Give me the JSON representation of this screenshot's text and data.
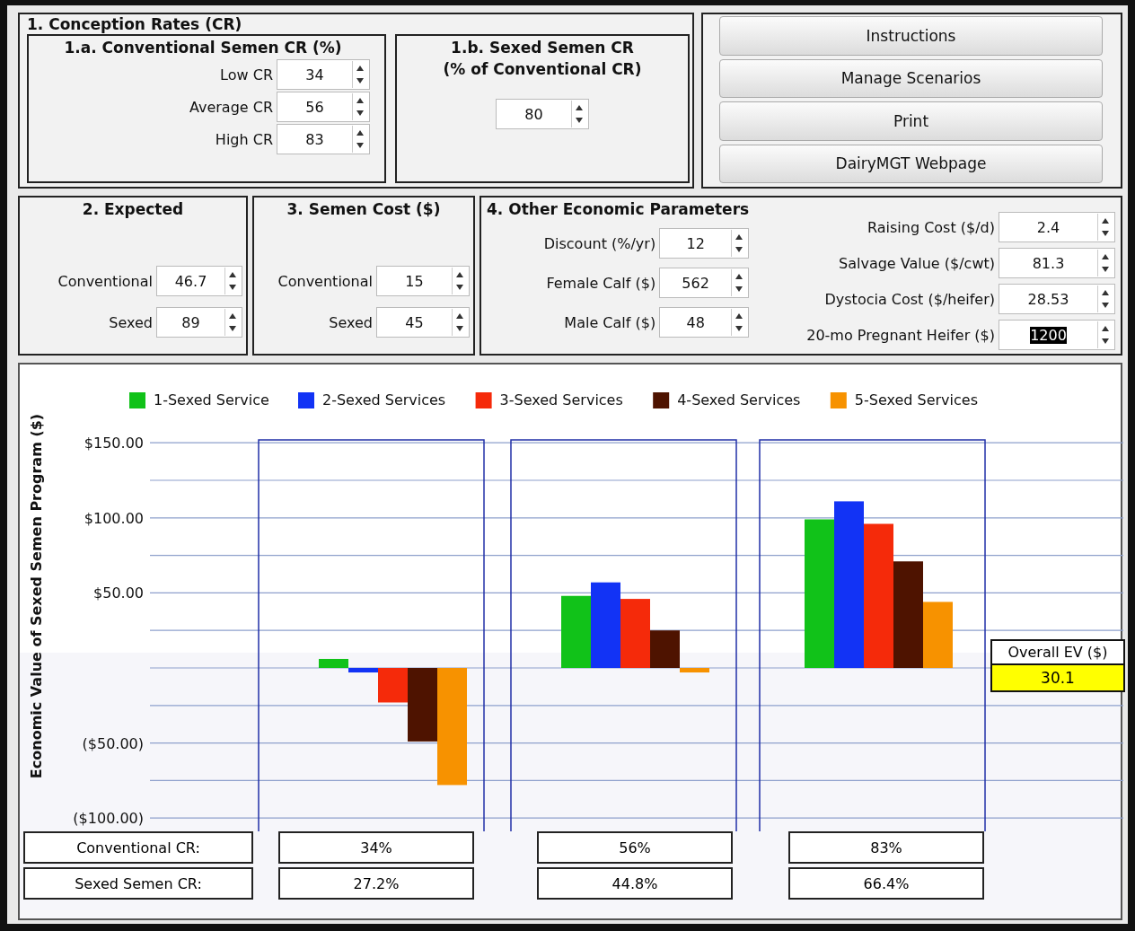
{
  "conception_rates": {
    "title": "1. Conception Rates (CR)",
    "conventional": {
      "title": "1.a. Conventional Semen CR (%)",
      "fields": [
        {
          "label": "Low CR",
          "value": "34"
        },
        {
          "label": "Average CR",
          "value": "56"
        },
        {
          "label": "High CR",
          "value": "83"
        }
      ]
    },
    "sexed": {
      "title": "1.b. Sexed Semen CR",
      "subtitle": "(% of Conventional CR)",
      "value": "80"
    }
  },
  "buttons": [
    "Instructions",
    "Manage Scenarios",
    "Print",
    "DairyMGT Webpage"
  ],
  "expected": {
    "title": "2. Expected",
    "fields": [
      {
        "label": "Conventional",
        "value": "46.7"
      },
      {
        "label": "Sexed",
        "value": "89"
      }
    ]
  },
  "semen_cost": {
    "title": "3. Semen Cost ($)",
    "fields": [
      {
        "label": "Conventional",
        "value": "15"
      },
      {
        "label": "Sexed",
        "value": "45"
      }
    ]
  },
  "other": {
    "title": "4. Other Economic Parameters",
    "left_fields": [
      {
        "label": "Discount (%/yr)",
        "value": "12",
        "text_selected": false
      },
      {
        "label": "Female Calf ($)",
        "value": "562",
        "text_selected": false
      },
      {
        "label": "Male Calf ($)",
        "value": "48",
        "text_selected": false
      }
    ],
    "right_fields": [
      {
        "label": "Raising Cost ($/d)",
        "value": "2.4",
        "text_selected": false
      },
      {
        "label": "Salvage Value ($/cwt)",
        "value": "81.3",
        "text_selected": false
      },
      {
        "label": "Dystocia Cost ($/heifer)",
        "value": "28.53",
        "text_selected": false
      },
      {
        "label": "20-mo Pregnant Heifer ($)",
        "value": "1200",
        "text_selected": true
      }
    ]
  },
  "chart": {
    "chart_data": {
      "type": "bar",
      "ylabel": "Economic Value of Sexed Semen Program ($)",
      "ylim": [
        -100,
        150
      ],
      "grid": true,
      "legend": "top",
      "yticks": [
        {
          "value": 150,
          "label": "$150.00"
        },
        {
          "value": 100,
          "label": "$100.00"
        },
        {
          "value": 50,
          "label": "$50.00"
        },
        {
          "value": -50,
          "label": "($50.00)"
        },
        {
          "value": -100,
          "label": "($100.00)"
        }
      ],
      "series": [
        {
          "name": "1-Sexed Service",
          "color": "#11c219",
          "values": [
            6,
            48,
            99
          ]
        },
        {
          "name": "2-Sexed Services",
          "color": "#1233f5",
          "values": [
            -3,
            57,
            111
          ]
        },
        {
          "name": "3-Sexed Services",
          "color": "#f52a0a",
          "values": [
            -23,
            46,
            96
          ]
        },
        {
          "name": "4-Sexed Services",
          "color": "#4e1300",
          "values": [
            -49,
            25,
            71
          ]
        },
        {
          "name": "5-Sexed Services",
          "color": "#f79200",
          "values": [
            -78,
            -3,
            44
          ]
        }
      ]
    },
    "overall_ev": {
      "label": "Overall EV ($)",
      "value": "30.1"
    },
    "rows": [
      {
        "label": "Conventional CR:",
        "values": [
          "34%",
          "56%",
          "83%"
        ]
      },
      {
        "label": "Sexed Semen CR:",
        "values": [
          "27.2%",
          "44.8%",
          "66.4%"
        ]
      }
    ]
  }
}
